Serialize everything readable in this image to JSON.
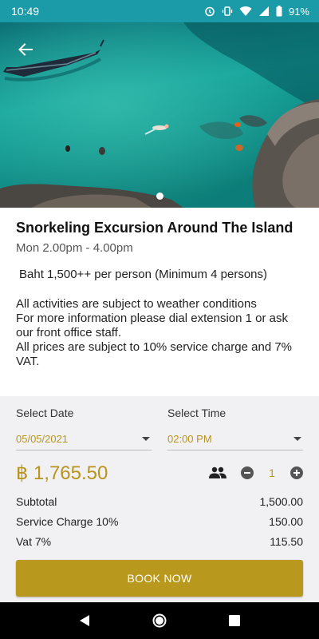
{
  "status": {
    "time": "10:49",
    "battery": "91%",
    "icons": [
      "alarm-icon",
      "vibrate-icon",
      "wifi-icon",
      "signal-icon",
      "battery-icon"
    ]
  },
  "hero": {
    "image": "snorkelers in turquoise sea with longtail boat and rocks",
    "back_icon": "arrow-back-icon",
    "page_indicator_active": 1
  },
  "activity": {
    "title": "Snorkeling Excursion Around The Island",
    "schedule": "Mon 2.00pm - 4.00pm",
    "price_line": "Baht 1,500++ per person (Minimum 4 persons)",
    "notes": [
      "All activities are subject to weather conditions",
      "For more information please dial extension 1 or ask our front office staff.",
      "All prices are subject to 10% service charge and 7% VAT."
    ]
  },
  "booking": {
    "date_label": "Select Date",
    "date_value": "05/05/2021",
    "time_label": "Select Time",
    "time_value": "02:00 PM",
    "total": "฿ 1,765.50",
    "quantity": "1",
    "rows": [
      {
        "label": "Subtotal",
        "value": "1,500.00"
      },
      {
        "label": "Service Charge 10%",
        "value": "150.00"
      },
      {
        "label": "Vat 7%",
        "value": "115.50"
      }
    ],
    "button_label": "BOOK NOW"
  },
  "colors": {
    "status_bar": "#1b9aa8",
    "accent": "#b8941c",
    "button": "#b8981d",
    "panel": "#f1f1f3"
  }
}
